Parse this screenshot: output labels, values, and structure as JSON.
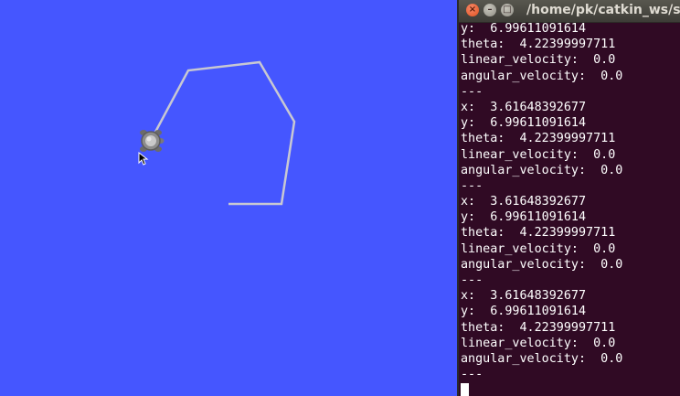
{
  "colors": {
    "sim_background": "#4556ff",
    "trail": "#c8c8d2",
    "terminal_background": "#300a24",
    "terminal_text": "#ffffff"
  },
  "simulator": {
    "turtle_icon": "turtle-icon",
    "mouse_cursor_icon": "mouse-pointer-icon"
  },
  "terminal": {
    "title": "/home/pk/catkin_ws/sr",
    "window_buttons": [
      "close-icon",
      "minimize-icon",
      "maximize-icon"
    ],
    "lines": [
      "y:  6.99611091614",
      "theta:  4.22399997711",
      "linear_velocity:  0.0",
      "angular_velocity:  0.0",
      "---",
      "x:  3.61648392677",
      "y:  6.99611091614",
      "theta:  4.22399997711",
      "linear_velocity:  0.0",
      "angular_velocity:  0.0",
      "---",
      "x:  3.61648392677",
      "y:  6.99611091614",
      "theta:  4.22399997711",
      "linear_velocity:  0.0",
      "angular_velocity:  0.0",
      "---",
      "x:  3.61648392677",
      "y:  6.99611091614",
      "theta:  4.22399997711",
      "linear_velocity:  0.0",
      "angular_velocity:  0.0",
      "---"
    ]
  }
}
